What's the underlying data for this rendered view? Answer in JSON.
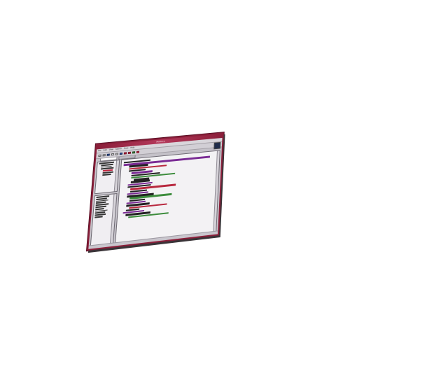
{
  "window": {
    "title": "Perforce",
    "menus": [
      "File",
      "Edit",
      "View",
      "Search",
      "Tools",
      "Help"
    ]
  },
  "toolbar": {
    "buttons": [
      "new",
      "open",
      "save",
      "cut",
      "copy",
      "paste",
      "undo",
      "redo",
      "run",
      "stop"
    ]
  },
  "tabs": [
    "Project",
    "Files"
  ],
  "colors": {
    "titlebar": "#8b1f3a",
    "accent": "#c0243e",
    "keyword": "#7a2b94",
    "string": "#b8283e",
    "comment": "#3c8c3c"
  }
}
